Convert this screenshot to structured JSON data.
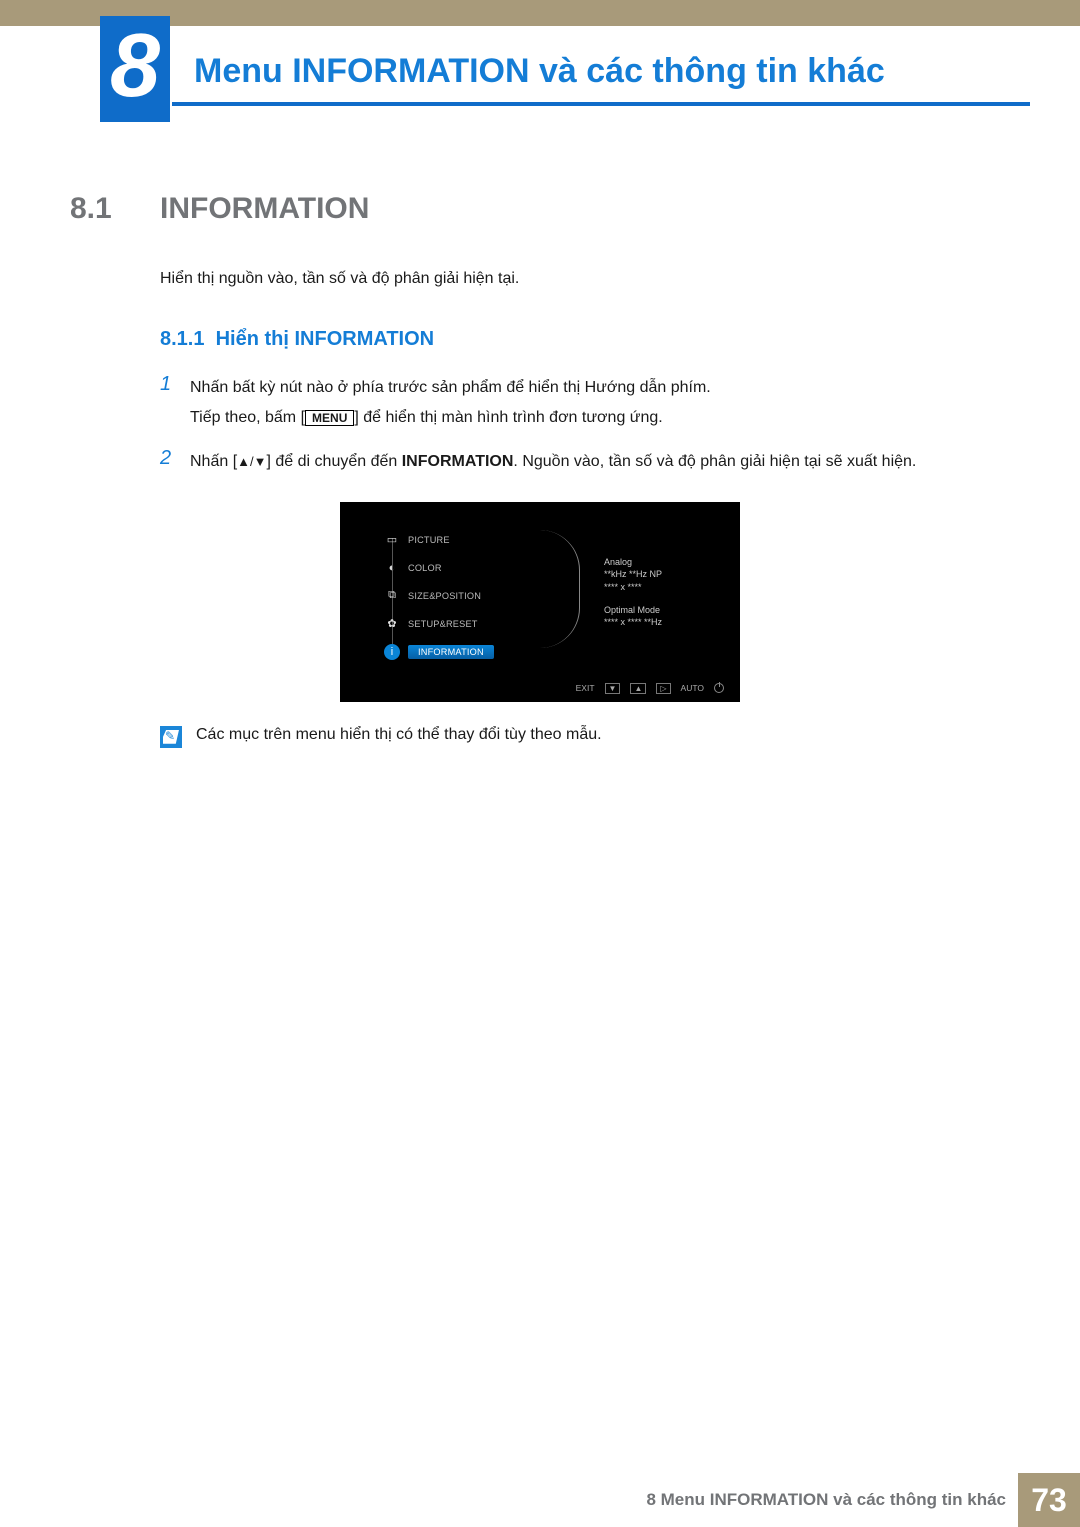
{
  "chapter_number": "8",
  "chapter_title": "Menu INFORMATION và các thông tin khác",
  "section": {
    "number": "8.1",
    "title": "INFORMATION",
    "intro": "Hiển thị nguồn vào, tần số và độ phân giải hiện tại."
  },
  "subsection": {
    "number": "8.1.1",
    "title": "Hiển thị INFORMATION"
  },
  "steps": [
    {
      "num": "1",
      "text_a": "Nhấn bất kỳ nút nào ở phía trước sản phẩm để hiển thị Hướng dẫn phím.",
      "text_b_pre": "Tiếp theo, bấm [",
      "text_b_btn": "MENU",
      "text_b_post": "] để hiển thị màn hình trình đơn tương ứng."
    },
    {
      "num": "2",
      "text_pre": "Nhấn [",
      "arrow_up": "▲",
      "arrow_sep": "/",
      "arrow_down": "▼",
      "text_mid": "] để di chuyển đến ",
      "bold": "INFORMATION",
      "text_post": ". Nguồn vào, tần số và độ phân giải hiện tại sẽ xuất hiện."
    }
  ],
  "osd_menu_items": [
    {
      "icon": "picture-icon",
      "glyph": "▭",
      "label": "PICTURE"
    },
    {
      "icon": "color-icon",
      "glyph": "◐",
      "label": "COLOR"
    },
    {
      "icon": "size-icon",
      "glyph": "⧉",
      "label": "SIZE&POSITION"
    },
    {
      "icon": "setup-icon",
      "glyph": "✿",
      "label": "SETUP&RESET"
    },
    {
      "icon": "info-icon",
      "glyph": "i",
      "label": "INFORMATION",
      "selected": true
    }
  ],
  "osd_info": {
    "l1": "Analog",
    "l2": "**kHz **Hz NP",
    "l3": "**** x ****",
    "l4": "Optimal Mode",
    "l5": "**** x ****  **Hz"
  },
  "osd_footer": {
    "exit": "EXIT",
    "down": "▼",
    "up": "▲",
    "enter": "▷",
    "auto": "AUTO"
  },
  "note": "Các mục trên menu hiển thị có thể thay đổi tùy theo mẫu.",
  "footer": {
    "text": "8 Menu INFORMATION và các thông tin khác",
    "page": "73"
  }
}
